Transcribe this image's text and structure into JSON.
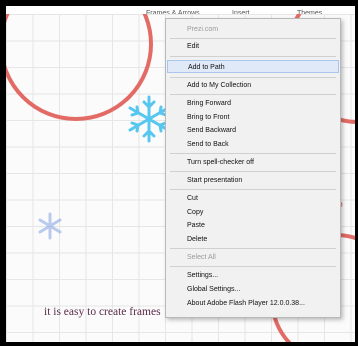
{
  "toolbar": {
    "tabs": [
      "Frames & Arrows",
      "Insert",
      "Themes"
    ]
  },
  "canvas": {
    "main_text": "it is easy to create frames",
    "fragment_text": "to",
    "colors": {
      "frame_stroke": "#e36b66",
      "snowflake": "#57c7ef",
      "text": "#5a2b4a"
    }
  },
  "context_menu": {
    "items": [
      {
        "label": "Prezi.com",
        "disabled": true
      },
      {
        "label": "Edit"
      },
      {
        "label": "Add to Path",
        "highlighted": true
      },
      {
        "label": "Add to My Collection"
      },
      {
        "label": "Bring Forward"
      },
      {
        "label": "Bring to Front"
      },
      {
        "label": "Send Backward"
      },
      {
        "label": "Send to Back"
      },
      {
        "label": "Turn spell-checker off"
      },
      {
        "label": "Start presentation"
      },
      {
        "label": "Cut"
      },
      {
        "label": "Copy"
      },
      {
        "label": "Paste"
      },
      {
        "label": "Delete"
      },
      {
        "label": "Select All",
        "disabled": true
      },
      {
        "label": "Settings..."
      },
      {
        "label": "Global Settings..."
      },
      {
        "label": "About Adobe Flash Player 12.0.0.38..."
      }
    ]
  }
}
